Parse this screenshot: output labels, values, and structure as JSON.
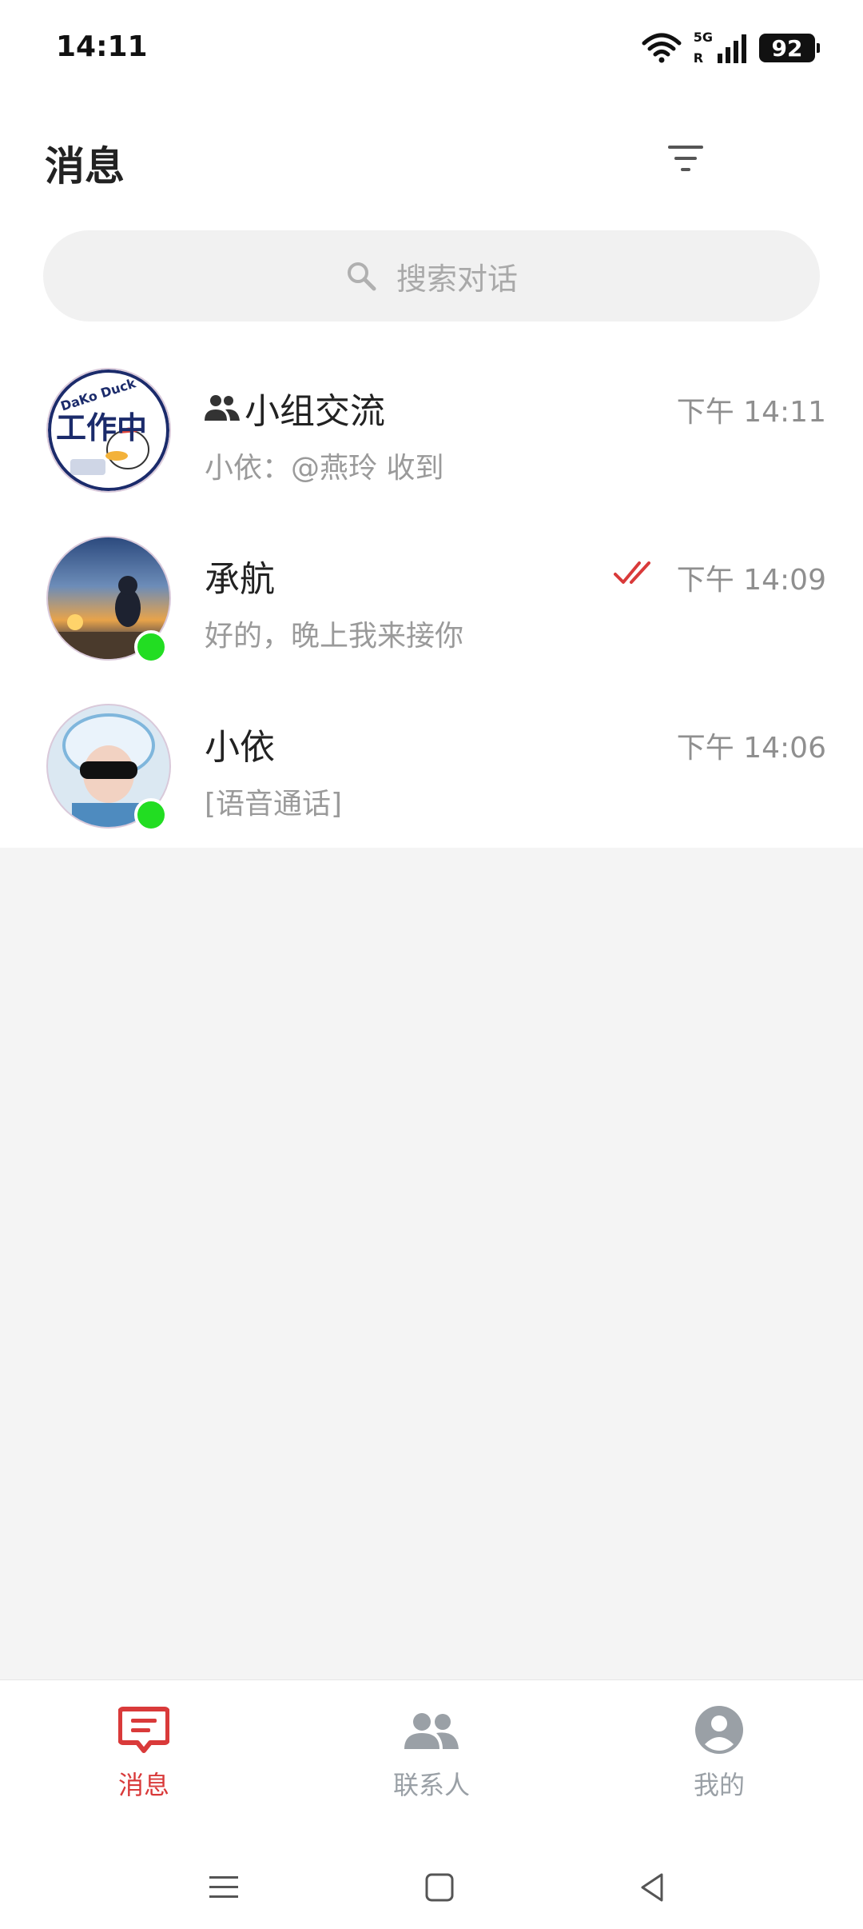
{
  "status_bar": {
    "time": "14:11",
    "network": "5G",
    "roaming": "R",
    "battery": "92"
  },
  "header": {
    "title": "消息",
    "filter_icon": "filter-icon"
  },
  "search": {
    "placeholder": "搜索对话",
    "icon": "search-icon"
  },
  "conversations": [
    {
      "name": "小组交流",
      "is_group": true,
      "time": "下午 14:11",
      "preview": "小依：@燕玲 收到",
      "avatar_text": "工作中",
      "avatar_badge": "DaKo Duck",
      "online": false,
      "read": false
    },
    {
      "name": "承航",
      "is_group": false,
      "time": "下午 14:09",
      "preview": "好的，晚上我来接你",
      "online": true,
      "read": true
    },
    {
      "name": "小依",
      "is_group": false,
      "time": "下午 14:06",
      "preview": "[语音通话]",
      "online": true,
      "read": false
    }
  ],
  "bottom_nav": {
    "items": [
      {
        "label": "消息",
        "icon": "message-icon",
        "active": true
      },
      {
        "label": "联系人",
        "icon": "contacts-icon",
        "active": false
      },
      {
        "label": "我的",
        "icon": "profile-icon",
        "active": false
      }
    ]
  },
  "colors": {
    "accent": "#d93a3a",
    "inactive": "#9aa0a6",
    "online": "#22dd22"
  }
}
